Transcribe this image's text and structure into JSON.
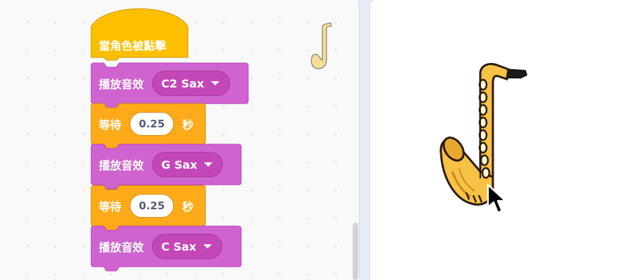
{
  "script": {
    "hat": {
      "label": "當角色被點擊"
    },
    "blocks": [
      {
        "type": "play_sound",
        "label": "播放音效",
        "sound": "C2 Sax"
      },
      {
        "type": "wait",
        "label": "等待",
        "value": "0.25",
        "unit": "秒"
      },
      {
        "type": "play_sound",
        "label": "播放音效",
        "sound": "G Sax"
      },
      {
        "type": "wait",
        "label": "等待",
        "value": "0.25",
        "unit": "秒"
      },
      {
        "type": "play_sound",
        "label": "播放音效",
        "sound": "C Sax"
      }
    ]
  },
  "sprite": {
    "name": "saxophone-icon"
  },
  "colors": {
    "events": "#ffbf00",
    "sound": "#cf63cf",
    "control": "#ffab19",
    "stage_bg": "#ffffff"
  }
}
